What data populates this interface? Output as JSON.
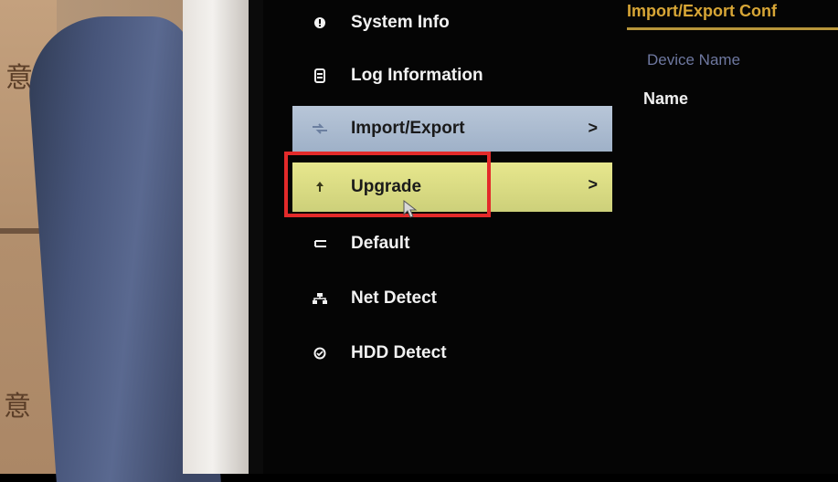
{
  "menu": {
    "items": [
      {
        "label": "System Info",
        "icon": "info-icon"
      },
      {
        "label": "Log Information",
        "icon": "log-icon"
      },
      {
        "label": "Import/Export",
        "icon": "import-export-icon",
        "chevron": ">"
      },
      {
        "label": "Upgrade",
        "icon": "upgrade-icon",
        "chevron": ">"
      },
      {
        "label": "Default",
        "icon": "default-icon"
      },
      {
        "label": "Net Detect",
        "icon": "net-detect-icon"
      },
      {
        "label": "HDD Detect",
        "icon": "hdd-detect-icon"
      }
    ],
    "selected": "Import/Export",
    "hovered": "Upgrade"
  },
  "panel": {
    "title": "Import/Export Conf",
    "device_name_label": "Device Name",
    "name_label": "Name"
  },
  "colors": {
    "selected_item": "#a8b8cc",
    "hover_item": "#d9dc82",
    "highlight_box": "#e32a2a",
    "panel_title": "#d8a636"
  },
  "background": {
    "box_char": "意"
  }
}
